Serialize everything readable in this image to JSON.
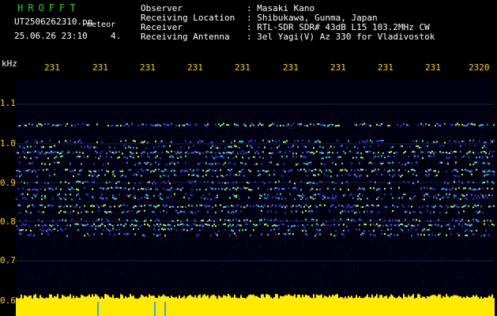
{
  "header": {
    "title": "HROFFT",
    "filename": "UT2506262310.pn",
    "filename_sub": "meteor",
    "datetime": "25.06.26 23:10",
    "datetime_sub": "4.",
    "info": [
      {
        "label": "Observer",
        "value": ": Masaki Kano"
      },
      {
        "label": "Receiving Location",
        "value": ": Shibukawa, Gunma, Japan"
      },
      {
        "label": "Receiver",
        "value": ": RTL-SDR SDR# 43dB L15 103.2MHz CW"
      },
      {
        "label": "Receiving Antenna",
        "value": ": 3el Yagi(V) Az 330 for Vladivostok"
      }
    ]
  },
  "axis": {
    "unit": "kHz",
    "x_ticks": [
      "231",
      "231",
      "231",
      "231",
      "231",
      "231",
      "231",
      "231",
      "231",
      "2320"
    ],
    "y_ticks": [
      "1.1",
      "1.0",
      "0.9",
      "0.8",
      "0.7",
      "0.6"
    ]
  },
  "colors": {
    "title": "#16d21d",
    "tick": "#ffd400",
    "background": "#000010",
    "level_bar": "#ffeb00"
  }
}
